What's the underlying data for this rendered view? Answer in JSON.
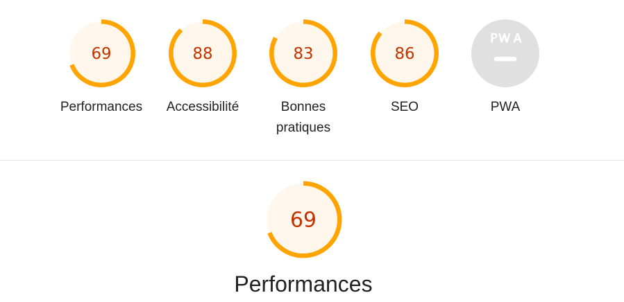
{
  "colors": {
    "average": "#ffa400",
    "average_fill": "#fff7ec",
    "average_text": "#c33300",
    "pwa_gray": "#e0e0e0",
    "pwa_badge": "#ffffff"
  },
  "gauges": [
    {
      "label": "Performances",
      "score": "69",
      "value": 0.69,
      "icon": "performance-gauge"
    },
    {
      "label": "Accessibilité",
      "score": "88",
      "value": 0.88,
      "icon": "accessibility-gauge"
    },
    {
      "label": "Bonnes pratiques",
      "score": "83",
      "value": 0.83,
      "icon": "best-practices-gauge"
    },
    {
      "label": "SEO",
      "score": "86",
      "value": 0.86,
      "icon": "seo-gauge"
    },
    {
      "label": "PWA",
      "badge": "PWA",
      "icon": "pwa-badge-icon"
    }
  ],
  "main": {
    "score": "69",
    "value": 0.69,
    "title": "Performances"
  }
}
